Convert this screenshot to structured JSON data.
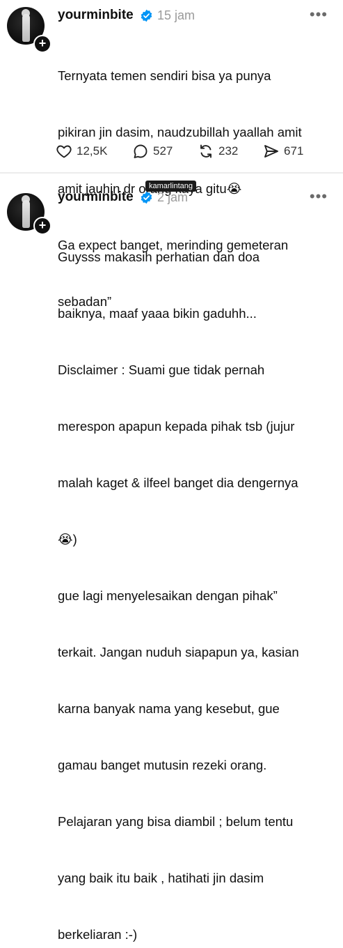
{
  "posts": [
    {
      "username": "yourminbite",
      "time": "15 jam",
      "lines": [
        "Ternyata temen sendiri bisa ya punya",
        "pikiran jin dasim, naudzubillah yaallah amit",
        "amit jauhin dr orang kaya gitu😭",
        "Ga expect banget, merinding gemeteran",
        "sebadan”"
      ],
      "stats": {
        "likes": "12,5K",
        "replies": "527",
        "reposts": "232",
        "shares": "671"
      }
    },
    {
      "username": "yourminbite",
      "time": "2 jam",
      "lines": [
        "Guysss makasih perhatian dan doa",
        "baiknya, maaf yaaa bikin gaduhh...",
        "Disclaimer : Suami gue tidak pernah",
        "merespon apapun kepada pihak tsb (jujur",
        "malah kaget & ilfeel banget dia dengernya",
        "😭)",
        "gue lagi menyelesaikan dengan pihak”",
        "terkait. Jangan nuduh siapapun ya, kasian",
        "karna banyak nama yang kesebut, gue",
        "gamau banget mutusin rezeki orang.",
        "Pelajaran yang bisa diambil ; belum tentu",
        "yang baik itu baik , hatihati jin dasim",
        "berkeliaran :-)"
      ]
    }
  ],
  "watermark": "kamarlintang",
  "icons": {
    "more": "more-icon",
    "verified": "verified-badge-icon",
    "follow": "plus-icon",
    "like": "heart-icon",
    "reply": "comment-icon",
    "repost": "repost-icon",
    "share": "share-icon"
  },
  "colors": {
    "verified": "#0095f6",
    "text": "#101010",
    "muted": "#9a9a9a"
  }
}
